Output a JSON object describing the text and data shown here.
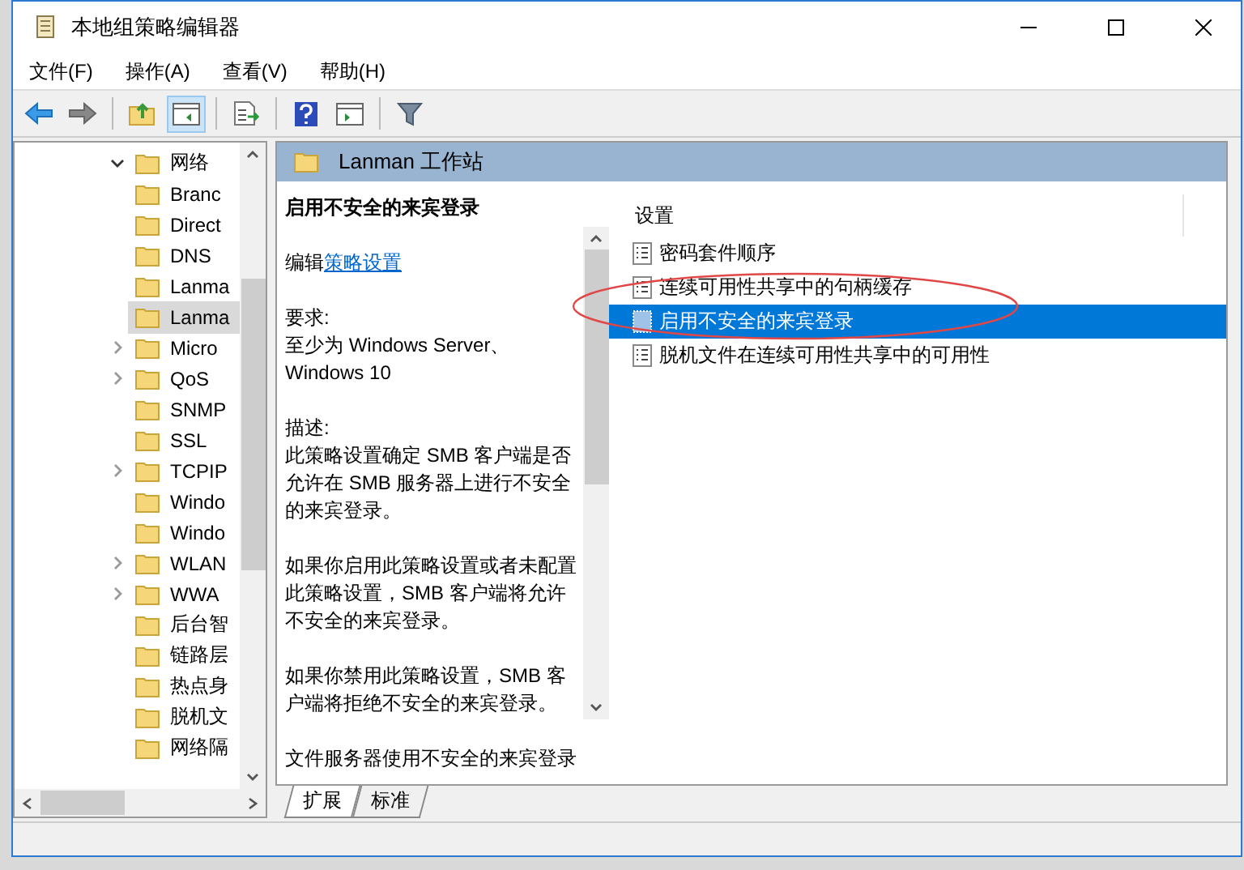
{
  "window": {
    "title": "本地组策略编辑器"
  },
  "menu": [
    "文件(F)",
    "操作(A)",
    "查看(V)",
    "帮助(H)"
  ],
  "toolbar": [
    {
      "kind": "back"
    },
    {
      "kind": "forward"
    },
    {
      "kind": "sep"
    },
    {
      "kind": "up"
    },
    {
      "kind": "panel",
      "selected": true
    },
    {
      "kind": "sep"
    },
    {
      "kind": "export"
    },
    {
      "kind": "sep"
    },
    {
      "kind": "help"
    },
    {
      "kind": "panel2",
      "selected": false
    },
    {
      "kind": "sep"
    },
    {
      "kind": "filter"
    }
  ],
  "tree": {
    "items": [
      {
        "label": "网络",
        "expandable": true,
        "expanded": true,
        "selected": false,
        "children": [
          {
            "label": "Branc",
            "expandable": false,
            "selected": false
          },
          {
            "label": "Direct",
            "expandable": false,
            "selected": false
          },
          {
            "label": "DNS",
            "expandable": false,
            "selected": false
          },
          {
            "label": "Lanma",
            "expandable": false,
            "selected": false
          },
          {
            "label": "Lanma",
            "expandable": false,
            "selected": true
          },
          {
            "label": "Micro",
            "expandable": true,
            "expanded": false,
            "selected": false
          },
          {
            "label": "QoS",
            "expandable": true,
            "expanded": false,
            "selected": false
          },
          {
            "label": "SNMP",
            "expandable": false,
            "selected": false
          },
          {
            "label": "SSL",
            "expandable": false,
            "selected": false
          },
          {
            "label": "TCPIP",
            "expandable": true,
            "expanded": false,
            "selected": false
          },
          {
            "label": "Windo",
            "expandable": false,
            "selected": false
          },
          {
            "label": "Windo",
            "expandable": false,
            "selected": false
          },
          {
            "label": "WLAN",
            "expandable": true,
            "expanded": false,
            "selected": false
          },
          {
            "label": "WWA",
            "expandable": true,
            "expanded": false,
            "selected": false
          },
          {
            "label": "后台智",
            "expandable": false,
            "selected": false
          },
          {
            "label": "链路层",
            "expandable": false,
            "selected": false
          },
          {
            "label": "热点身",
            "expandable": false,
            "selected": false
          },
          {
            "label": "脱机文",
            "expandable": false,
            "selected": false
          },
          {
            "label": "网络隔",
            "expandable": false,
            "selected": false
          }
        ]
      }
    ]
  },
  "header": {
    "title": "Lanman 工作站"
  },
  "description": {
    "title": "启用不安全的来宾登录",
    "edit_prefix": "编辑",
    "edit_link": "策略设置",
    "paragraphs": [
      "要求:\n至少为 Windows Server、Windows 10",
      "描述:\n此策略设置确定 SMB 客户端是否允许在 SMB 服务器上进行不安全的来宾登录。",
      "如果你启用此策略设置或者未配置此策略设置，SMB 客户端将允许不安全的来宾登录。",
      "如果你禁用此策略设置，SMB 客户端将拒绝不安全的来宾登录。",
      "文件服务器使用不安全的来宾登录"
    ]
  },
  "settings": {
    "column": "设置",
    "rows": [
      {
        "label": "密码套件顺序",
        "selected": false
      },
      {
        "label": "连续可用性共享中的句柄缓存",
        "selected": false
      },
      {
        "label": "启用不安全的来宾登录",
        "selected": true
      },
      {
        "label": "脱机文件在连续可用性共享中的可用性",
        "selected": false
      }
    ]
  },
  "tabs": [
    {
      "label": "扩展",
      "selected": true
    },
    {
      "label": "标准",
      "selected": false
    }
  ]
}
